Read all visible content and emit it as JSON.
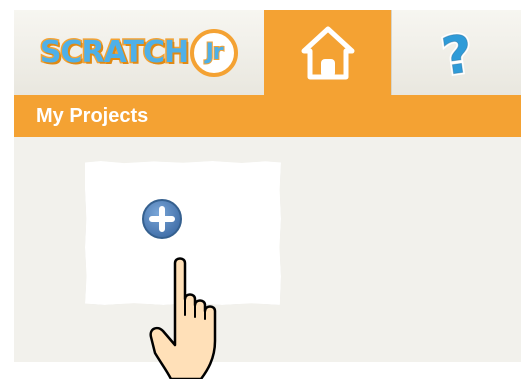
{
  "app": {
    "logo_text": "SCRATCH",
    "logo_badge": "Jr"
  },
  "tabs": [
    {
      "name": "home",
      "icon": "home-icon",
      "active": true
    },
    {
      "name": "help",
      "icon": "question-mark-icon",
      "active": false
    }
  ],
  "header": {
    "title": "My Projects"
  },
  "projects": {
    "new_project_icon": "plus-circle-icon"
  },
  "overlay": {
    "pointer_icon": "pointing-hand-icon"
  },
  "colors": {
    "accent": "#f4a233",
    "logo_blue": "#4fb0e8",
    "plus_blue": "#4a7bb5",
    "background": "#f2f1ec"
  }
}
